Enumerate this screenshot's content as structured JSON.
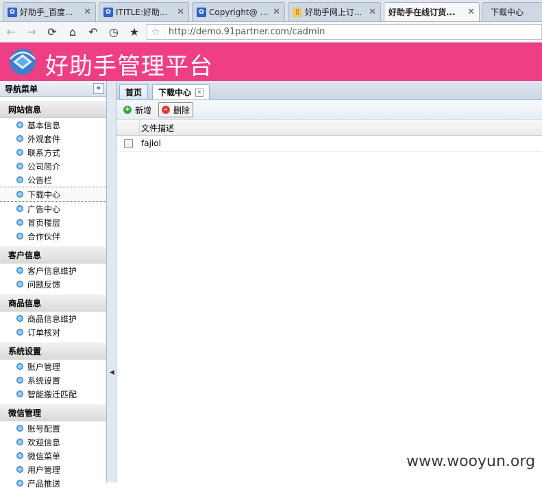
{
  "browser": {
    "tabs": [
      {
        "title": "好助手_百度...",
        "icon": "paw-icon"
      },
      {
        "title": "ITITLE:好助...",
        "icon": "paw-icon"
      },
      {
        "title": "Copyright@ 2...",
        "icon": "paw-icon"
      },
      {
        "title": "好助手网上订...",
        "icon": "page-icon"
      },
      {
        "title": "好助手在线订货...",
        "icon": "none"
      },
      {
        "title": "下载中心",
        "icon": "none"
      }
    ],
    "close_glyph": "✕",
    "url": "http://demo.91partner.com/cadmin"
  },
  "header": {
    "brand": "好助手管理平台",
    "color": "#ee3f84"
  },
  "sidebar": {
    "title": "导航菜单",
    "collapse_glyph": "«",
    "groups": [
      {
        "label": "网站信息",
        "items": [
          "基本信息",
          "外观套件",
          "联系方式",
          "公司简介",
          "公告栏",
          "下载中心",
          "广告中心",
          "首页楼层",
          "合作伙伴"
        ]
      },
      {
        "label": "客户信息",
        "items": [
          "客户信息维护",
          "问题反馈"
        ]
      },
      {
        "label": "商品信息",
        "items": [
          "商品信息维护",
          "订单核对"
        ]
      },
      {
        "label": "系统设置",
        "items": [
          "账户管理",
          "系统设置",
          "智能搬迁匹配"
        ]
      },
      {
        "label": "微信管理",
        "items": [
          "账号配置",
          "欢迎信息",
          "微信菜单",
          "用户管理",
          "产品推送"
        ]
      }
    ],
    "selected": "下载中心"
  },
  "main": {
    "tabs": [
      {
        "label": "首页"
      },
      {
        "label": "下载中心"
      }
    ],
    "toolbar": {
      "add_label": "新增",
      "delete_label": "删除"
    },
    "grid": {
      "columns": [
        "文件描述"
      ],
      "rows": [
        [
          "fajiol"
        ]
      ]
    }
  },
  "watermark": "www.wooyun.org"
}
